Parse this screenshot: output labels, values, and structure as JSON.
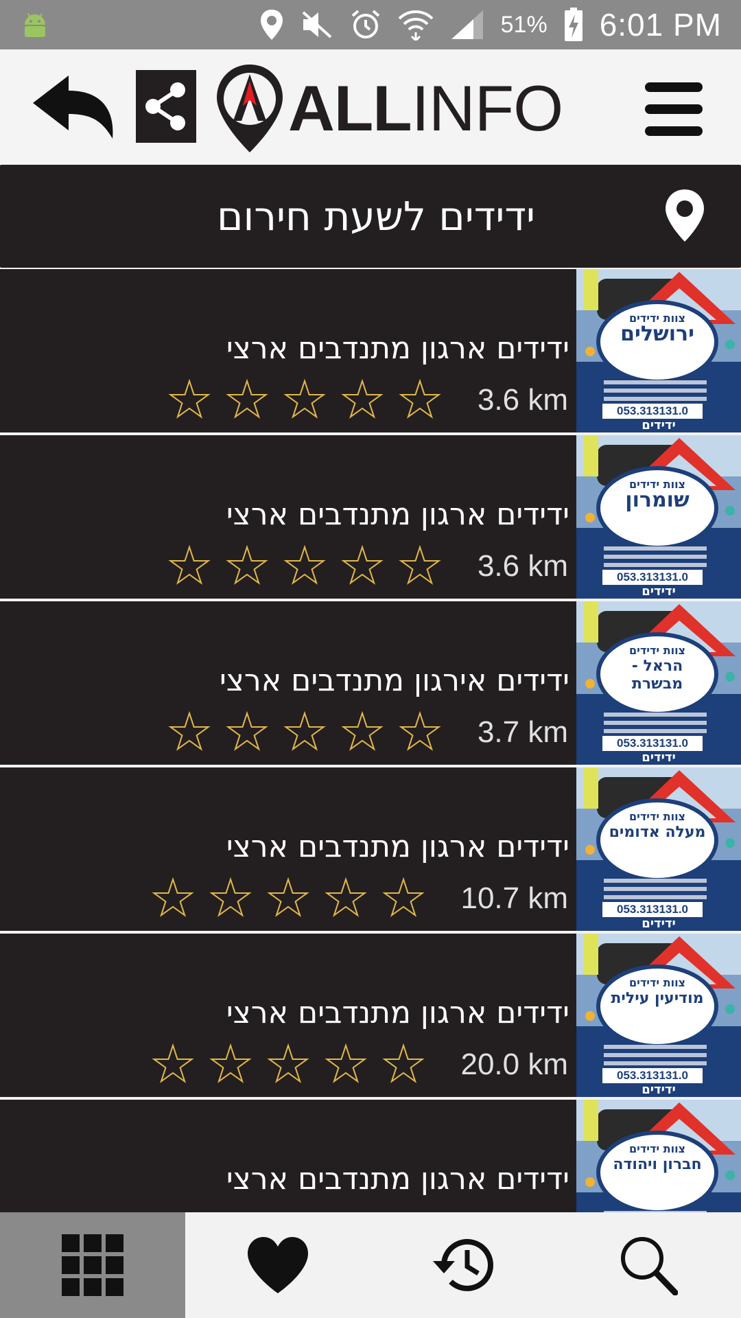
{
  "status_bar": {
    "battery_percent": "51%",
    "time": "6:01 PM"
  },
  "app_bar": {
    "logo_text_bold": "ALL",
    "logo_text_light": "INFO"
  },
  "title_bar": {
    "title": "ידידים לשעת חירום"
  },
  "list": {
    "items": [
      {
        "name": "ידידים ארגון מתנדבים ארצי",
        "distance": "3.6 km",
        "rating": 0,
        "thumb_label_1": "צוות ידידים",
        "thumb_label_2": "ירושלים",
        "thumb_phone": "053.313131.0",
        "thumb_brand": "ידידים"
      },
      {
        "name": "ידידים ארגון מתנדבים ארצי",
        "distance": "3.6 km",
        "rating": 0,
        "thumb_label_1": "צוות ידידים",
        "thumb_label_2": "שומרון",
        "thumb_phone": "053.313131.0",
        "thumb_brand": "ידידים"
      },
      {
        "name": "ידידים אירגון מתנדבים ארצי",
        "distance": "3.7 km",
        "rating": 0,
        "thumb_label_1": "צוות ידידים",
        "thumb_label_2": "הראל - מבשרת",
        "thumb_phone": "053.313131.0",
        "thumb_brand": "ידידים"
      },
      {
        "name": "ידידים ארגון מתנדבים ארצי",
        "distance": "10.7 km",
        "rating": 0,
        "thumb_label_1": "צוות ידידים",
        "thumb_label_2": "מעלה אדומים",
        "thumb_phone": "053.313131.0",
        "thumb_brand": "ידידים"
      },
      {
        "name": "ידידים ארגון מתנדבים ארצי",
        "distance": "20.0 km",
        "rating": 0,
        "thumb_label_1": "צוות ידידים",
        "thumb_label_2": "מודיעין עילית",
        "thumb_phone": "053.313131.0",
        "thumb_brand": "ידידים"
      },
      {
        "name": "ידידים ארגון מתנדבים ארצי",
        "distance": "",
        "rating": 0,
        "thumb_label_1": "צוות ידידים",
        "thumb_label_2": "חברון ויהודה",
        "thumb_phone": "",
        "thumb_brand": ""
      }
    ]
  },
  "bottom_nav": {
    "items": [
      {
        "icon": "grid-icon",
        "active": true
      },
      {
        "icon": "heart-icon",
        "active": false
      },
      {
        "icon": "history-icon",
        "active": false
      },
      {
        "icon": "search-icon",
        "active": false
      }
    ]
  },
  "colors": {
    "status_bar_bg": "#8a8a8a",
    "row_bg": "#231f20",
    "star_outline": "#e1b74a",
    "logo_red": "#e31d25",
    "thumb_blue": "#1d3f7a"
  }
}
